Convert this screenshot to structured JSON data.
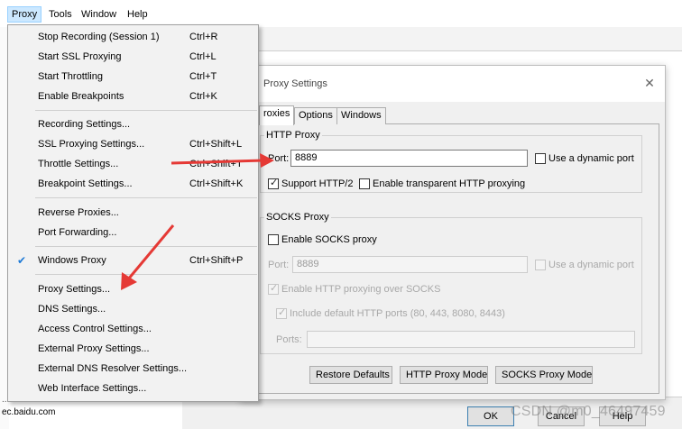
{
  "menubar": {
    "items": [
      "Proxy",
      "Tools",
      "Window",
      "Help"
    ]
  },
  "proxy_menu": {
    "items": [
      {
        "label": "Stop Recording (Session 1)",
        "shortcut": "Ctrl+R"
      },
      {
        "label": "Start SSL Proxying",
        "shortcut": "Ctrl+L"
      },
      {
        "label": "Start Throttling",
        "shortcut": "Ctrl+T"
      },
      {
        "label": "Enable Breakpoints",
        "shortcut": "Ctrl+K"
      },
      {
        "label": "Recording Settings...",
        "shortcut": ""
      },
      {
        "label": "SSL Proxying Settings...",
        "shortcut": "Ctrl+Shift+L"
      },
      {
        "label": "Throttle Settings...",
        "shortcut": "Ctrl+Shift+T"
      },
      {
        "label": "Breakpoint Settings...",
        "shortcut": "Ctrl+Shift+K"
      },
      {
        "label": "Reverse Proxies...",
        "shortcut": ""
      },
      {
        "label": "Port Forwarding...",
        "shortcut": ""
      },
      {
        "label": "Windows Proxy",
        "shortcut": "Ctrl+Shift+P",
        "checked": true
      },
      {
        "label": "Proxy Settings...",
        "shortcut": ""
      },
      {
        "label": "DNS Settings...",
        "shortcut": ""
      },
      {
        "label": "Access Control Settings...",
        "shortcut": ""
      },
      {
        "label": "External Proxy Settings...",
        "shortcut": ""
      },
      {
        "label": "External DNS Resolver Settings...",
        "shortcut": ""
      },
      {
        "label": "Web Interface Settings...",
        "shortcut": ""
      }
    ]
  },
  "dialog": {
    "title": "Proxy Settings",
    "close_glyph": "✕",
    "tabs": [
      "roxies",
      "Options",
      "Windows"
    ],
    "http_proxy": {
      "group_label": "HTTP Proxy",
      "port_label": "Port:",
      "port_value": "8889",
      "dynamic_port_label": "Use a dynamic port",
      "support_http2_label": "Support HTTP/2",
      "support_http2_checked": true,
      "transparent_label": "Enable transparent HTTP proxying",
      "transparent_checked": false
    },
    "socks_proxy": {
      "group_label": "SOCKS Proxy",
      "enable_label": "Enable SOCKS proxy",
      "enable_checked": false,
      "port_label": "Port:",
      "port_value": "8889",
      "dynamic_port_label": "Use a dynamic port",
      "http_over_socks_label": "Enable HTTP proxying over SOCKS",
      "include_default_ports_label": "Include default HTTP ports (80, 443, 8080, 8443)",
      "ports_label": "Ports:",
      "ports_value": ""
    },
    "buttons": {
      "restore_defaults": "Restore Defaults",
      "http_proxy_mode": "HTTP Proxy Mode",
      "socks_proxy_mode": "SOCKS Proxy Mode"
    }
  },
  "background": {
    "host_partial": "...",
    "host": "ec.baidu.com",
    "ok_label": "OK",
    "cancel_label": "Cancel",
    "help_label": "Help"
  },
  "watermark": "CSDN @m0_46497459",
  "colors": {
    "arrow": "#e53935",
    "check_accent": "#1e7ad6",
    "menubar_highlight": "#cce8ff"
  },
  "icons": {
    "close": "close-icon",
    "check": "check-icon"
  }
}
